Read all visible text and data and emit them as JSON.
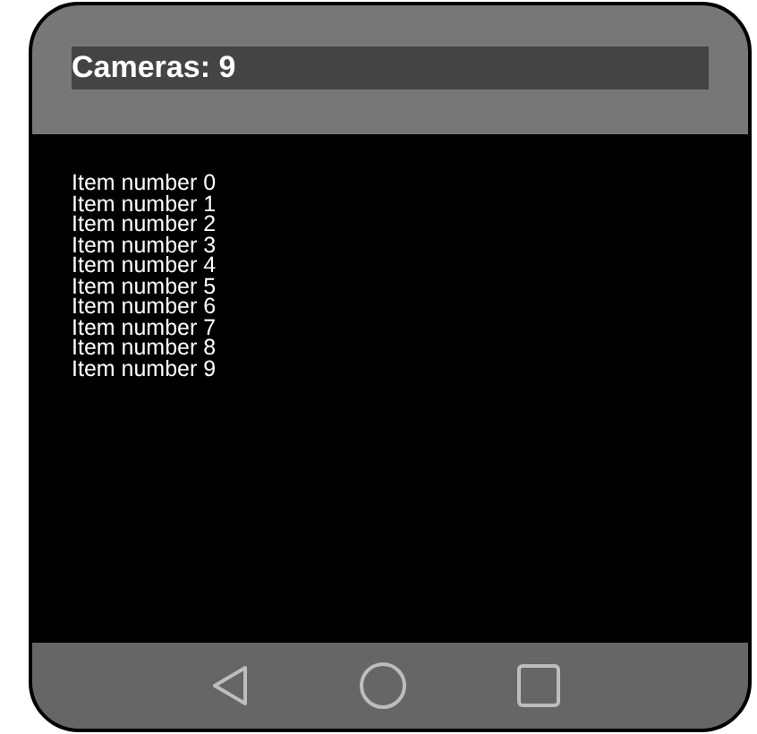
{
  "header": {
    "title": "Cameras: 9"
  },
  "items": [
    "Item number 0",
    "Item number 1",
    "Item number 2",
    "Item number 3",
    "Item number 4",
    "Item number 5",
    "Item number 6",
    "Item number 7",
    "Item number 8",
    "Item number 9"
  ],
  "nav_bar": {
    "buttons": [
      {
        "kind": "back"
      },
      {
        "kind": "home"
      },
      {
        "kind": "recents"
      }
    ]
  }
}
